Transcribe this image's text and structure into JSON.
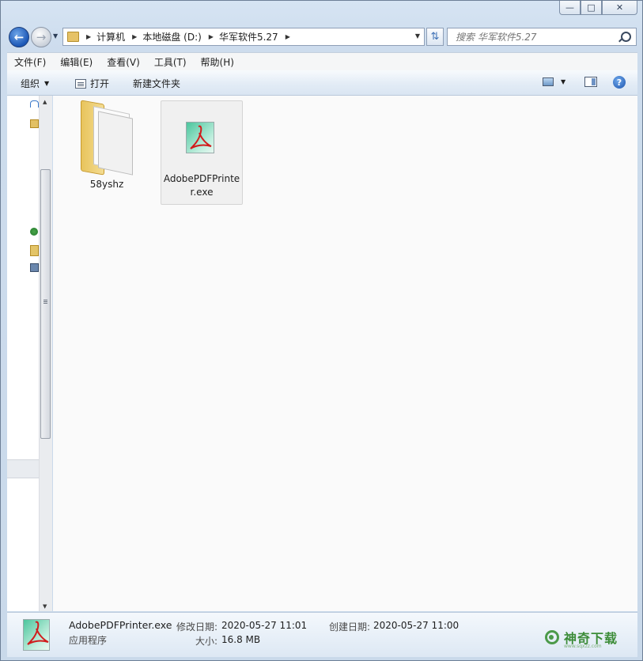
{
  "nav": {
    "breadcrumbs": [
      "计算机",
      "本地磁盘 (D:)",
      "华军软件5.27"
    ],
    "search_placeholder": "搜索 华军软件5.27"
  },
  "menu": [
    "文件(F)",
    "编辑(E)",
    "查看(V)",
    "工具(T)",
    "帮助(H)"
  ],
  "toolbar": {
    "organize": "组织",
    "open": "打开",
    "new_folder": "新建文件夹"
  },
  "files": [
    {
      "name": "58yshz",
      "type": "folder"
    },
    {
      "name": "AdobePDFPrinter.exe",
      "type": "exe",
      "selected": true
    }
  ],
  "details": {
    "name": "AdobePDFPrinter.exe",
    "type": "应用程序",
    "modified_label": "修改日期:",
    "modified_value": "2020-05-27 11:01",
    "created_label": "创建日期:",
    "created_value": "2020-05-27 11:00",
    "size_label": "大小:",
    "size_value": "16.8 MB"
  },
  "watermark": {
    "text": "神奇下载",
    "url": "www.sqxzz.com"
  }
}
